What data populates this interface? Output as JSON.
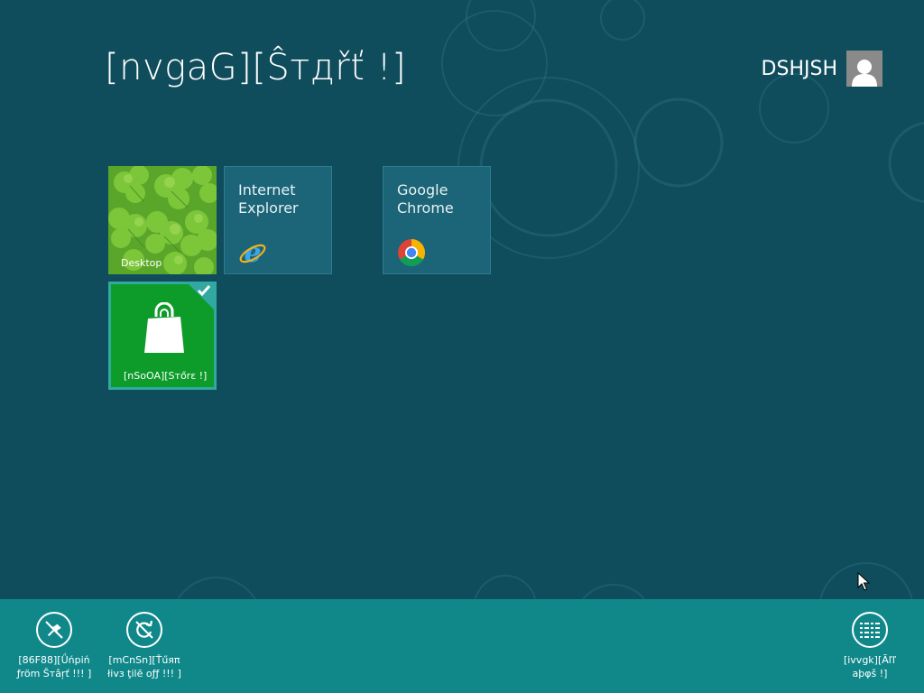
{
  "screen": {
    "title": "[nvgaG][Ŝтдřť !]"
  },
  "user": {
    "name": "DSHJSH",
    "icon": "user-avatar-icon"
  },
  "tiles": {
    "desktop": {
      "caption": "Desktop"
    },
    "ie": {
      "title": "Internet Explorer",
      "icon": "internet-explorer-icon"
    },
    "chrome": {
      "title": "Google Chrome",
      "icon": "chrome-icon"
    },
    "store": {
      "caption": "[nSoOA][Sтőrε !]",
      "icon": "store-bag-icon",
      "selected": true
    }
  },
  "app_bar": {
    "unpin": {
      "label": "[86F88][Ǘńpiń\nƒröm Ŝтâŗť !!! ]",
      "icon": "unpin-icon"
    },
    "turn_off_live_tile": {
      "label": "[mCnSn][Ťűяπ\nłivз ţilē oƒƒ !!! ]",
      "icon": "live-tile-off-icon"
    },
    "all_apps": {
      "label": "[ivvgk][Ãľľ\naþφš !]",
      "icon": "all-apps-icon"
    }
  },
  "colors": {
    "background": "#0f4c5c",
    "app_bar": "#10888a",
    "store_tile": "#0d9b2a",
    "app_tile": "#1c6477"
  }
}
